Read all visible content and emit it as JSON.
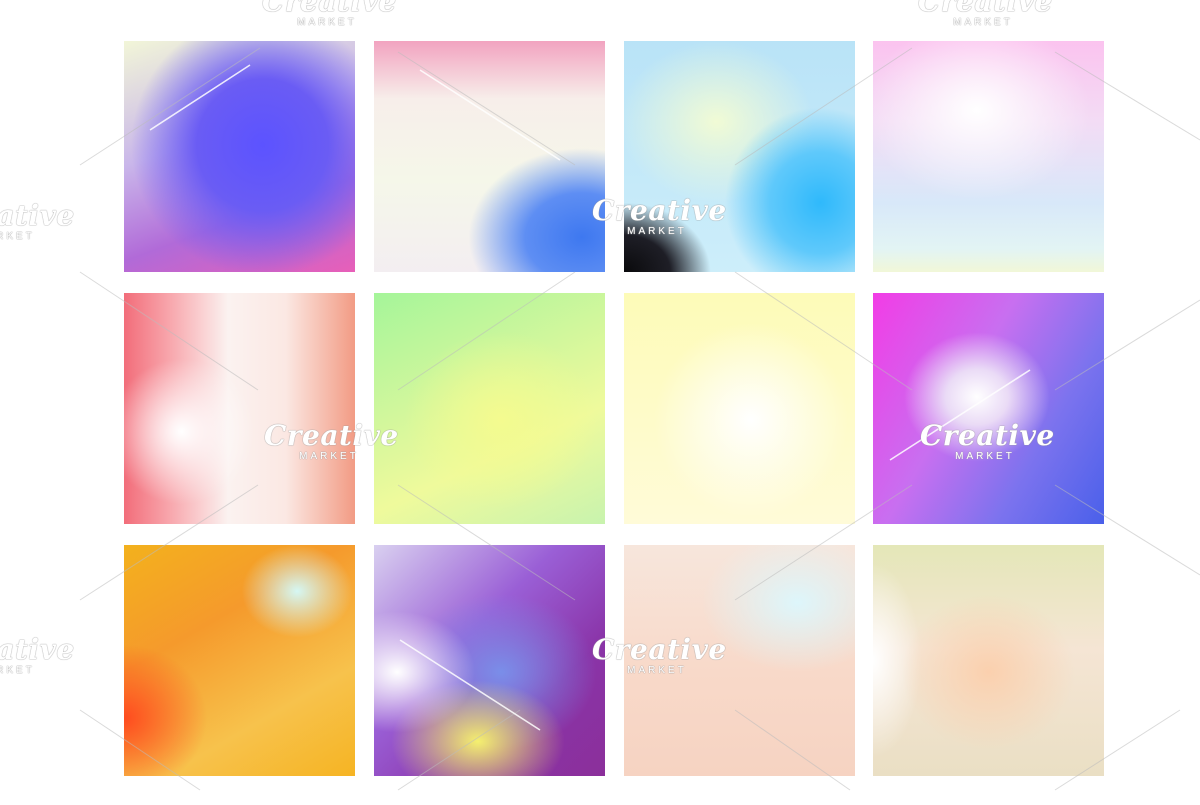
{
  "swatches": [
    {
      "name": "swatch-1",
      "colors": [
        "#f2f6d8",
        "#5c53ff",
        "#e85fb8"
      ]
    },
    {
      "name": "swatch-2",
      "colors": [
        "#f2a3c0",
        "#f5f7e9",
        "#3e78f0"
      ]
    },
    {
      "name": "swatch-3",
      "colors": [
        "#b9e3f7",
        "#2fb9fb",
        "#0a0a0c"
      ]
    },
    {
      "name": "swatch-4",
      "colors": [
        "#fbc3ef",
        "#ffffff",
        "#d8e8f9"
      ]
    },
    {
      "name": "swatch-5",
      "colors": [
        "#f26d7a",
        "#ffffff",
        "#f29b84"
      ]
    },
    {
      "name": "swatch-6",
      "colors": [
        "#a5f59a",
        "#f4fb8f",
        "#c8f3ae"
      ]
    },
    {
      "name": "swatch-7",
      "colors": [
        "#fdfbb8",
        "#ffffff"
      ]
    },
    {
      "name": "swatch-8",
      "colors": [
        "#f23ce6",
        "#ffffff",
        "#4a60ea"
      ]
    },
    {
      "name": "swatch-9",
      "colors": [
        "#f3b11d",
        "#ff4b1f",
        "#d5f7f4"
      ]
    },
    {
      "name": "swatch-10",
      "colors": [
        "#8b2f9a",
        "#7a8ee9",
        "#f5f06e"
      ]
    },
    {
      "name": "swatch-11",
      "colors": [
        "#f7e6dc",
        "#ddf6fb",
        "#f6d3c2"
      ]
    },
    {
      "name": "swatch-12",
      "colors": [
        "#e4e7b8",
        "#fbd0ae",
        "#eadfc4"
      ]
    }
  ],
  "watermark": {
    "brand": "Creative",
    "sub": "MARKET"
  }
}
